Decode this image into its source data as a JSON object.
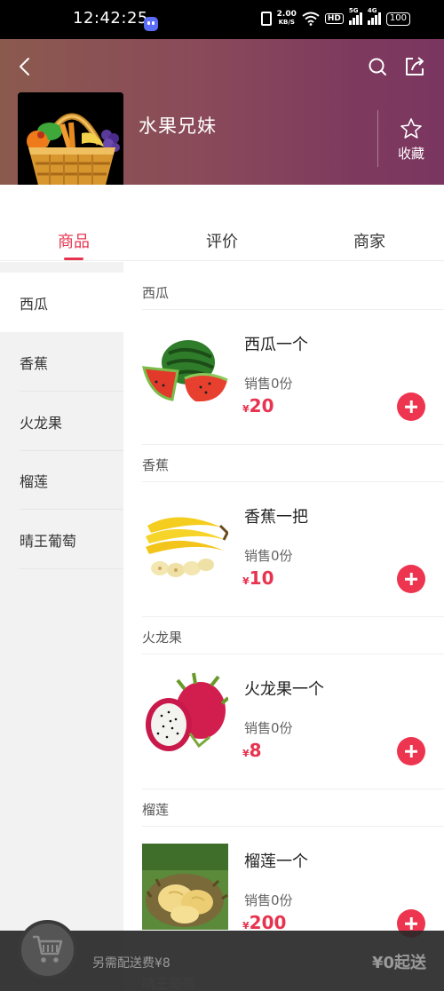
{
  "status_bar": {
    "time": "12:42:25",
    "net_speed_value": "2.00",
    "net_speed_unit": "KB/S",
    "hd_label": "HD",
    "signal_1_label": "5G",
    "signal_2_label": "4G",
    "battery": "100"
  },
  "header": {
    "shop_name": "水果兄妹",
    "favorite_label": "收藏",
    "colors": {
      "gradient_left": "#8b5a4e",
      "gradient_right": "#7a3660"
    }
  },
  "tabs": [
    {
      "label": "商品",
      "active": true
    },
    {
      "label": "评价",
      "active": false
    },
    {
      "label": "商家",
      "active": false
    }
  ],
  "sidebar": {
    "items": [
      {
        "label": "西瓜",
        "active": true
      },
      {
        "label": "香蕉",
        "active": false
      },
      {
        "label": "火龙果",
        "active": false
      },
      {
        "label": "榴莲",
        "active": false
      },
      {
        "label": "晴王葡萄",
        "active": false
      }
    ]
  },
  "sections": [
    {
      "category": "西瓜",
      "product": {
        "name": "西瓜一个",
        "sales": "销售0份",
        "currency": "¥",
        "price": "20",
        "image": "watermelon"
      }
    },
    {
      "category": "香蕉",
      "product": {
        "name": "香蕉一把",
        "sales": "销售0份",
        "currency": "¥",
        "price": "10",
        "image": "banana"
      }
    },
    {
      "category": "火龙果",
      "product": {
        "name": "火龙果一个",
        "sales": "销售0份",
        "currency": "¥",
        "price": "8",
        "image": "dragon-fruit"
      }
    },
    {
      "category": "榴莲",
      "product": {
        "name": "榴莲一个",
        "sales": "销售0份",
        "currency": "¥",
        "price": "200",
        "image": "durian"
      }
    }
  ],
  "cart": {
    "delivery_fee_text": "另需配送费¥8",
    "min_order_text": "¥0起送",
    "peek_category": "晴王葡萄"
  },
  "colors": {
    "accent": "#e8334f",
    "add_button": "#ee3550",
    "sidebar_bg": "#f2f2f2"
  }
}
